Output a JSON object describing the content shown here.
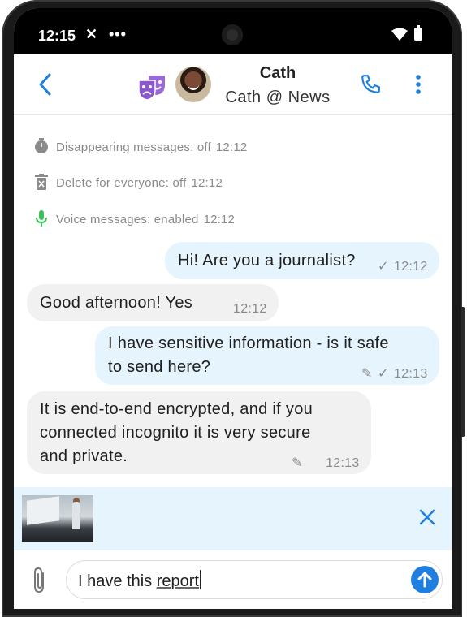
{
  "status_bar": {
    "time": "12:15",
    "x_symbol": "✕",
    "dots": "•••"
  },
  "header": {
    "contact_name": "Cath",
    "contact_subtitle": "Cath @ News",
    "mask_icon": "theater-masks-icon",
    "accent_color": "#1f7fe0",
    "mask_color": "#9b6ad6"
  },
  "events": [
    {
      "icon": "timer-icon",
      "text": "Disappearing messages: off",
      "time": "12:12"
    },
    {
      "icon": "trash-icon",
      "text": "Delete for everyone: off",
      "time": "12:12"
    },
    {
      "icon": "microphone-icon",
      "text": "Voice messages: enabled",
      "time": "12:12"
    }
  ],
  "messages": [
    {
      "direction": "out",
      "lines": [
        "Hi! Are you a journalist?"
      ],
      "time": "12:12",
      "edited": false,
      "status": "sent"
    },
    {
      "direction": "in",
      "lines": [
        "Good afternoon! Yes"
      ],
      "time": "12:12",
      "edited": false
    },
    {
      "direction": "out",
      "lines": [
        "I have sensitive information - is it safe",
        "to send here?"
      ],
      "time": "12:13",
      "edited": true,
      "status": "sent"
    },
    {
      "direction": "in",
      "lines": [
        "It is end-to-end encrypted, and if you",
        "connected incognito it is very secure",
        "and private."
      ],
      "time": "12:13",
      "edited": true
    }
  ],
  "compose": {
    "text_prefix": "I have this ",
    "text_underlined": "report"
  },
  "colors": {
    "outgoing_bubble": "#e6f4fd",
    "incoming_bubble": "#f1f1f1",
    "preview_bar": "#e6f4fd",
    "mic_icon": "#3fbf5a"
  }
}
